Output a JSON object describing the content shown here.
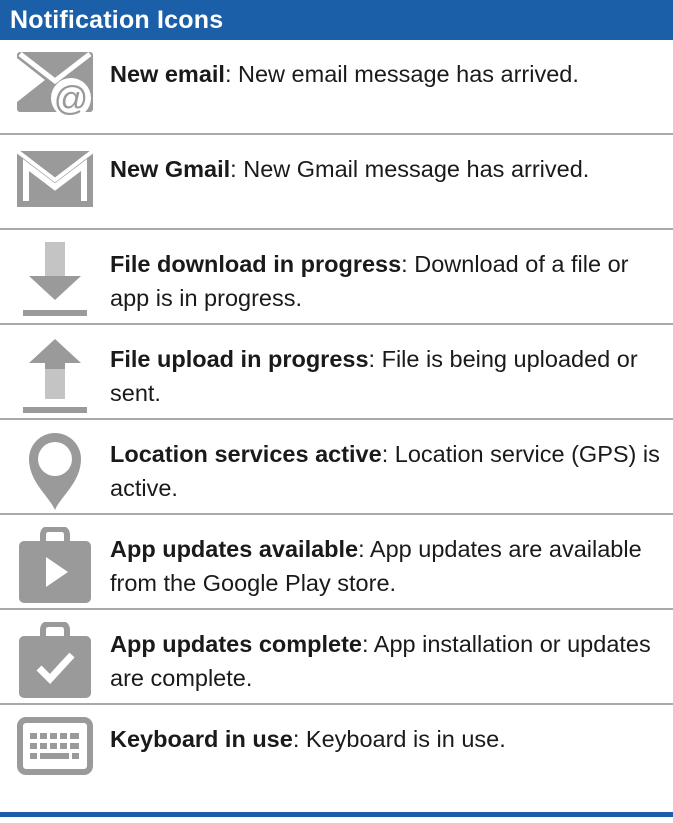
{
  "header": {
    "title": "Notification Icons"
  },
  "items": [
    {
      "icon": "email-at-icon",
      "term": "New email",
      "sep": ":",
      "description": " New email message has arrived."
    },
    {
      "icon": "gmail-icon",
      "term": "New Gmail",
      "sep": ":",
      "description": " New Gmail message has arrived."
    },
    {
      "icon": "download-arrow-icon",
      "term": "File download in progress",
      "sep": ":",
      "description": " Download of a file or app is in progress."
    },
    {
      "icon": "upload-arrow-icon",
      "term": "File upload in progress",
      "sep": ":",
      "description": " File is being uploaded or sent."
    },
    {
      "icon": "location-pin-icon",
      "term": "Location services active",
      "sep": ":",
      "description": " Location service (GPS) is active."
    },
    {
      "icon": "play-store-bag-icon",
      "term": "App updates available",
      "sep": ":",
      "description": " App updates are available from the Google Play store."
    },
    {
      "icon": "bag-checkmark-icon",
      "term": "App updates complete",
      "sep": ":",
      "description": " App installation or updates are complete."
    },
    {
      "icon": "keyboard-icon",
      "term": "Keyboard in use",
      "sep": ":",
      "description": " Keyboard is in use."
    }
  ],
  "colors": {
    "header_bg": "#1a5fa8",
    "header_text": "#ffffff",
    "icon_gray": "#9a9a9a",
    "divider": "#a7a9ac"
  }
}
